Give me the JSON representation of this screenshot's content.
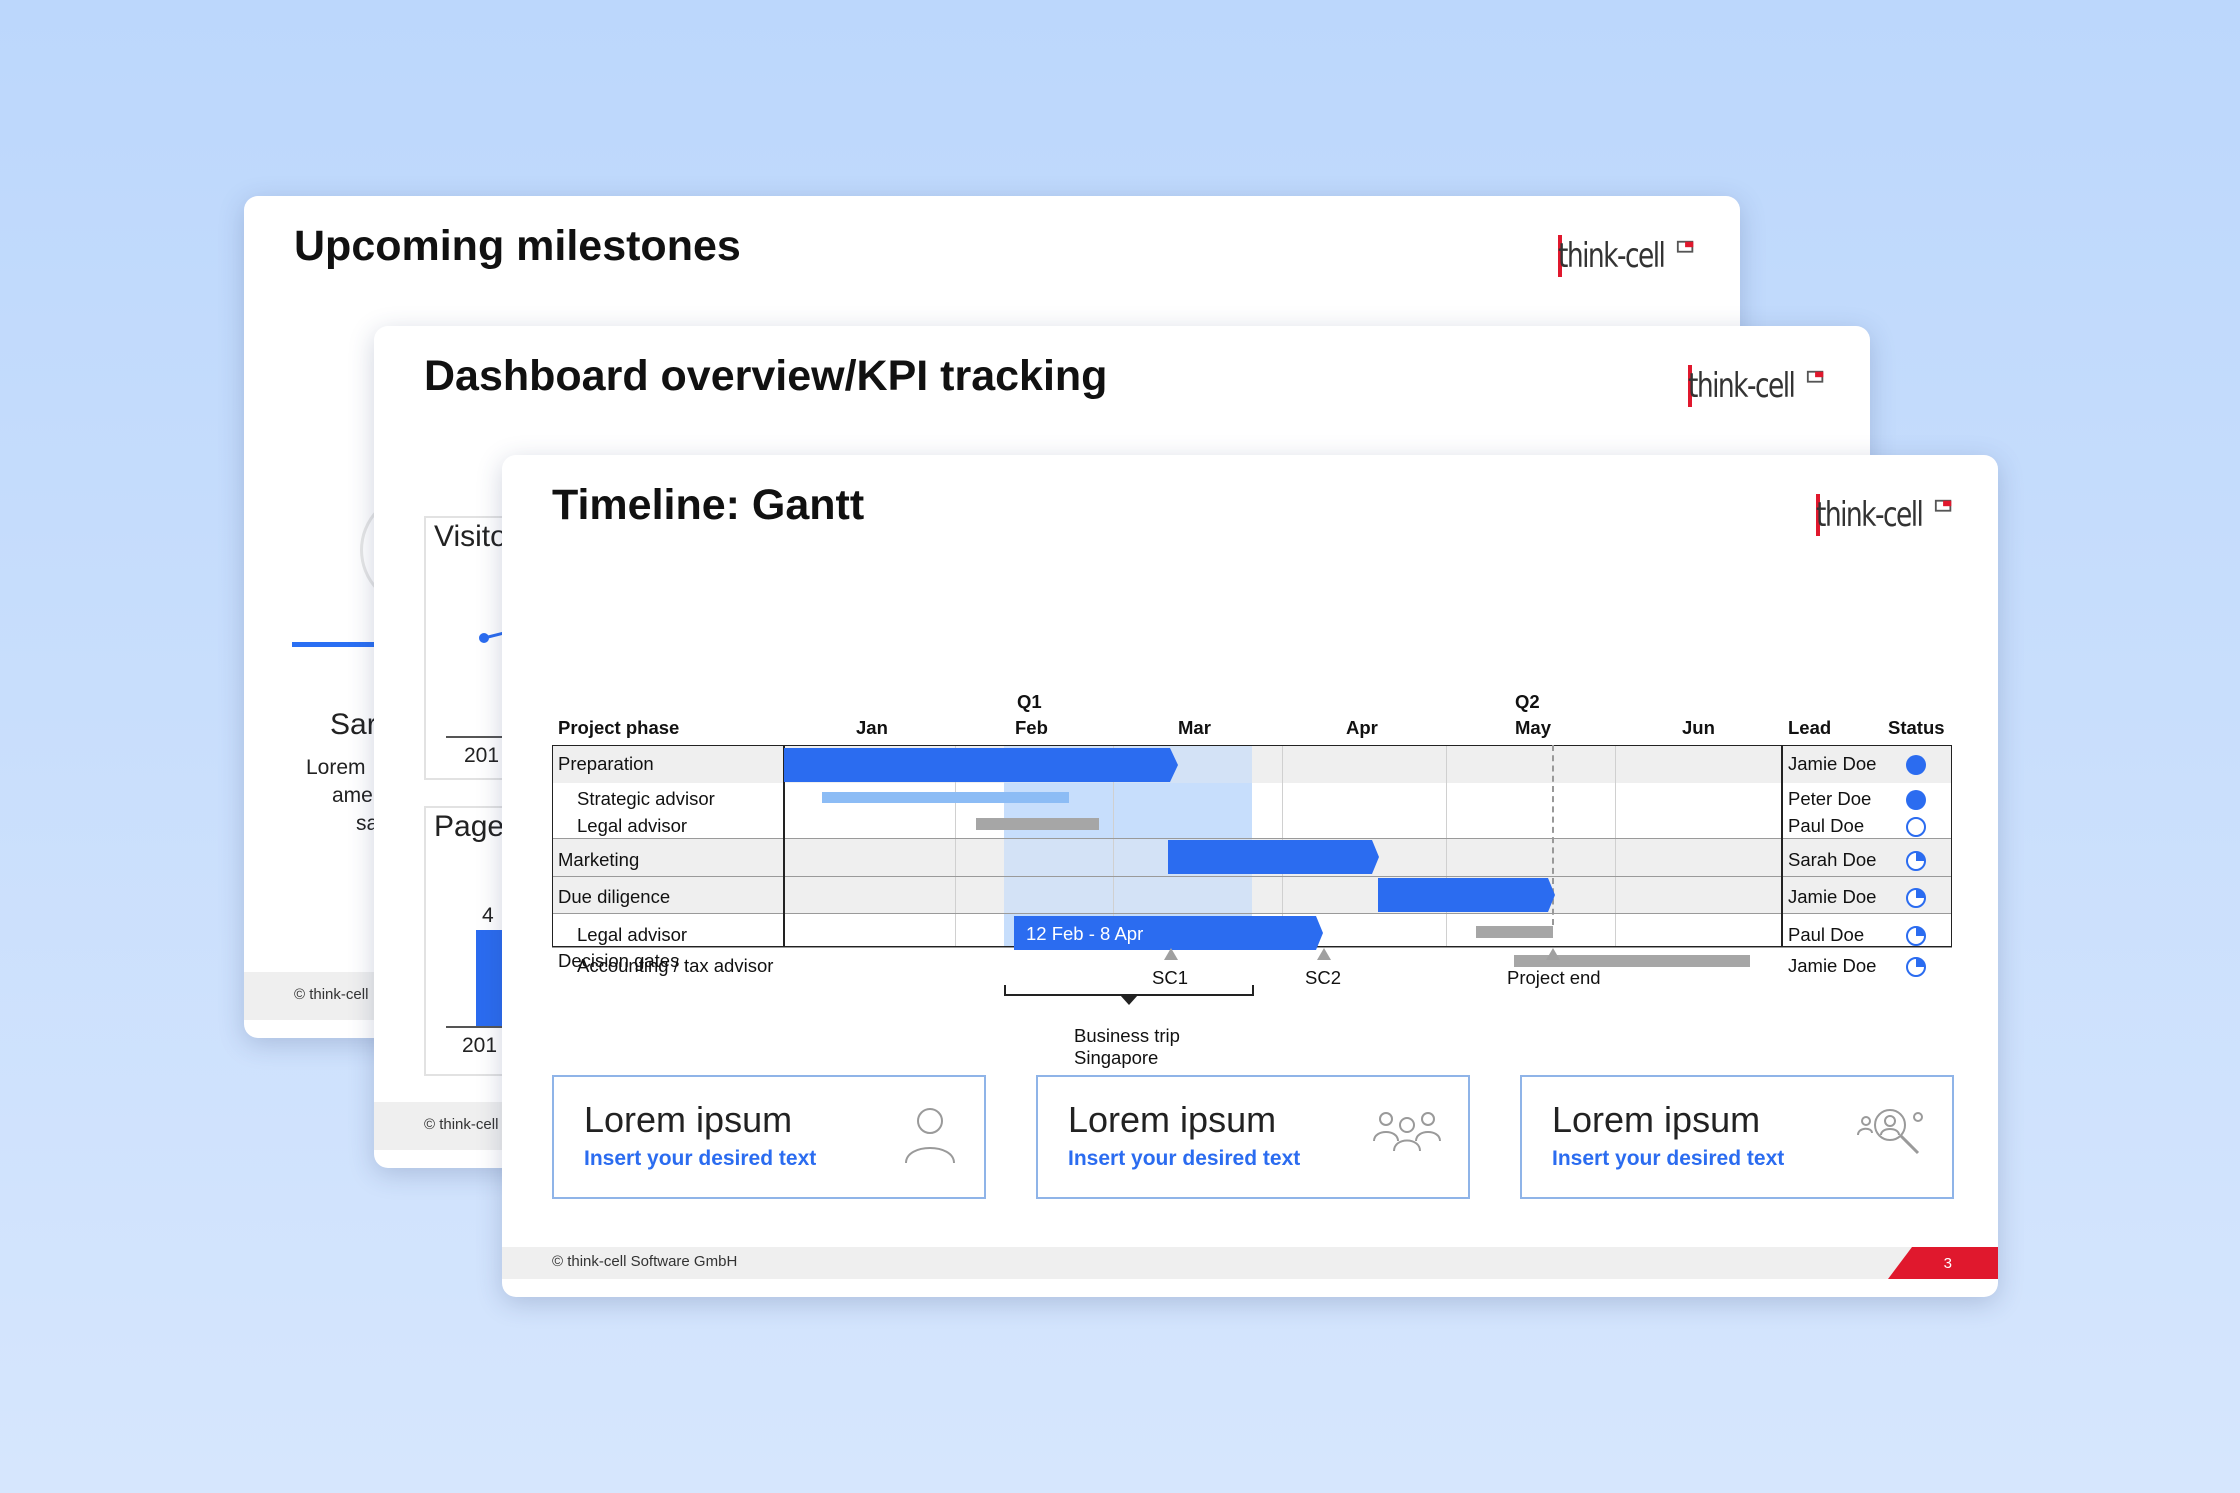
{
  "logo_text": "think-cell",
  "slide1": {
    "title": "Upcoming milestones",
    "name_partial": "Sar",
    "text_lines": [
      "Lorem",
      "ame",
      "sa"
    ],
    "footer": "© think-cell"
  },
  "slide2": {
    "title": "Dashboard overview/KPI tracking",
    "card1_label": "Visito",
    "card1_year": "201",
    "card2_label": "Page",
    "card2_value": "4",
    "card2_year": "201",
    "footer": "© think-cell"
  },
  "slide3": {
    "title": "Timeline: Gantt",
    "footer": "© think-cell Software GmbH",
    "page_number": "3",
    "header": {
      "project_phase": "Project phase",
      "quarters": [
        "Q1",
        "Q2"
      ],
      "months": [
        "Jan",
        "Feb",
        "Mar",
        "Apr",
        "May",
        "Jun"
      ],
      "lead": "Lead",
      "status": "Status"
    },
    "rows": [
      {
        "phase": "Preparation",
        "lead": "Jamie Doe",
        "status": "full"
      },
      {
        "phase": "Strategic advisor",
        "lead": "Peter Doe",
        "status": "full"
      },
      {
        "phase": "Legal advisor",
        "lead": "Paul Doe",
        "status": "empty"
      },
      {
        "phase": "Marketing",
        "lead": "Sarah Doe",
        "status": "quarter"
      },
      {
        "phase": "Due diligence",
        "lead": "Jamie Doe",
        "status": "quarter"
      },
      {
        "phase": "Legal advisor",
        "lead": "Paul Doe",
        "status": "quarter"
      },
      {
        "phase": "Accounting / tax advisor",
        "lead": "Jamie Doe",
        "status": "quarter"
      },
      {
        "phase": "Decision gates",
        "lead": "",
        "status": ""
      }
    ],
    "bar_label": "12 Feb - 8 Apr",
    "milestones": [
      "SC1",
      "SC2",
      "Project end"
    ],
    "bracket_label_line1": "Business trip",
    "bracket_label_line2": "Singapore",
    "boxes": [
      {
        "title": "Lorem ipsum",
        "subtitle": "Insert your desired text",
        "icon": "person-icon"
      },
      {
        "title": "Lorem ipsum",
        "subtitle": "Insert your desired text",
        "icon": "group-icon"
      },
      {
        "title": "Lorem ipsum",
        "subtitle": "Insert your desired text",
        "icon": "people-search-icon"
      }
    ]
  },
  "colors": {
    "accent_blue": "#2b6cf0",
    "light_blue": "#8cbcf5",
    "gray_bar": "#a6a6a6",
    "logo_red": "#e0182d",
    "highlight": "#d6e6fd"
  }
}
